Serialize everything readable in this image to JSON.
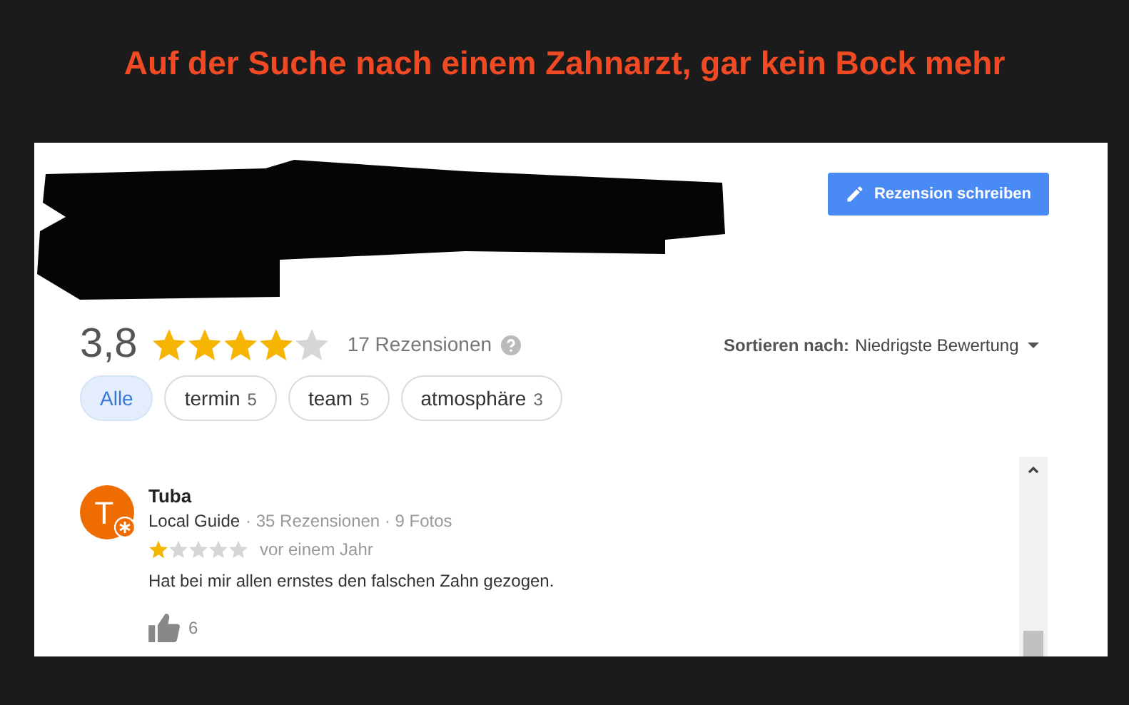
{
  "headline": "Auf der Suche nach einem Zahnarzt, gar kein Bock mehr",
  "write_review_button": "Rezension schreiben",
  "rating": {
    "score": "3,8",
    "stars": 4,
    "count": "17 Rezensionen"
  },
  "sort": {
    "label": "Sortieren nach:",
    "value": "Niedrigste Bewertung"
  },
  "filters": [
    {
      "label": "Alle",
      "selected": true
    },
    {
      "label": "termin",
      "count": "5",
      "selected": false
    },
    {
      "label": "team",
      "count": "5",
      "selected": false
    },
    {
      "label": "atmosphäre",
      "count": "3",
      "selected": false
    }
  ],
  "reviews": [
    {
      "avatar_letter": "T",
      "author": "Tuba",
      "badge": "Local Guide",
      "meta": "· 35 Rezensionen · 9 Fotos",
      "stars": 1,
      "time": "vor einem Jahr",
      "text": "Hat bei mir allen ernstes den falschen Zahn gezogen.",
      "likes": "6"
    }
  ]
}
